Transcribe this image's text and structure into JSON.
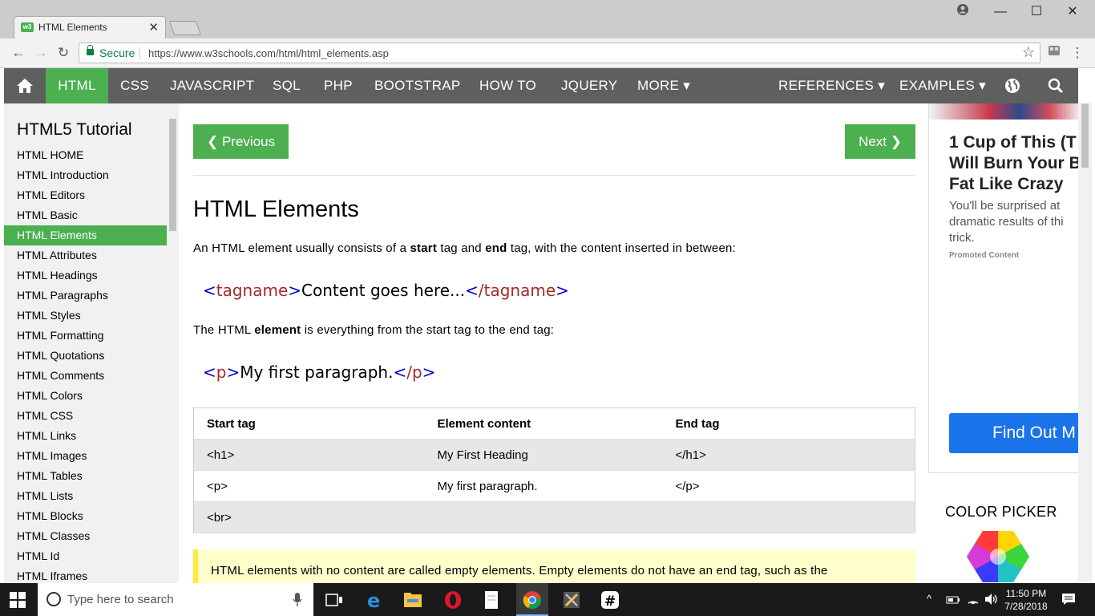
{
  "browser": {
    "tab_title": "HTML Elements",
    "tab_favicon": "w3",
    "secure_label": "Secure",
    "url": "https://www.w3schools.com/html/html_elements.asp"
  },
  "topnav": {
    "items": [
      "HTML",
      "CSS",
      "JAVASCRIPT",
      "SQL",
      "PHP",
      "BOOTSTRAP",
      "HOW TO",
      "JQUERY",
      "MORE ▾"
    ],
    "right_items": [
      "REFERENCES ▾",
      "EXAMPLES ▾"
    ],
    "accent": "#4caf50"
  },
  "sidebar": {
    "heading": "HTML5 Tutorial",
    "items": [
      "HTML HOME",
      "HTML Introduction",
      "HTML Editors",
      "HTML Basic",
      "HTML Elements",
      "HTML Attributes",
      "HTML Headings",
      "HTML Paragraphs",
      "HTML Styles",
      "HTML Formatting",
      "HTML Quotations",
      "HTML Comments",
      "HTML Colors",
      "HTML CSS",
      "HTML Links",
      "HTML Images",
      "HTML Tables",
      "HTML Lists",
      "HTML Blocks",
      "HTML Classes",
      "HTML Id",
      "HTML Iframes"
    ],
    "active_index": 4
  },
  "main": {
    "prev_label": "❮ Previous",
    "next_label": "Next ❯",
    "title": "HTML Elements",
    "intro_pre": "An HTML element usually consists of a ",
    "intro_start": "start",
    "intro_mid": " tag and ",
    "intro_end": "end",
    "intro_post": " tag, with the content inserted in between:",
    "code1": {
      "open": "tagname",
      "content": "Content goes here...",
      "close": "/tagname"
    },
    "para2_pre": "The HTML ",
    "para2_bold": "element",
    "para2_post": " is everything from the start tag to the end tag:",
    "code2": {
      "open": "p",
      "content": "My first paragraph.",
      "close": "/p"
    },
    "table": {
      "headers": [
        "Start tag",
        "Element content",
        "End tag"
      ],
      "rows": [
        [
          "<h1>",
          "My First Heading",
          "</h1>"
        ],
        [
          "<p>",
          "My first paragraph.",
          "</p>"
        ],
        [
          "<br>",
          "",
          ""
        ]
      ]
    },
    "note": "HTML elements with no content are called empty elements. Empty elements do not have an end tag, such as the"
  },
  "ad": {
    "headline_lines": [
      "1 Cup of This (T",
      "Will Burn Your B",
      "Fat Like Crazy"
    ],
    "desc_lines": [
      "You'll be surprised at",
      "dramatic results of thi",
      "trick."
    ],
    "promoted": "Promoted Content",
    "cta": "Find Out M"
  },
  "color_picker_label": "COLOR PICKER",
  "taskbar": {
    "search_placeholder": "Type here to search",
    "time": "11:50 PM",
    "date": "7/28/2018"
  }
}
